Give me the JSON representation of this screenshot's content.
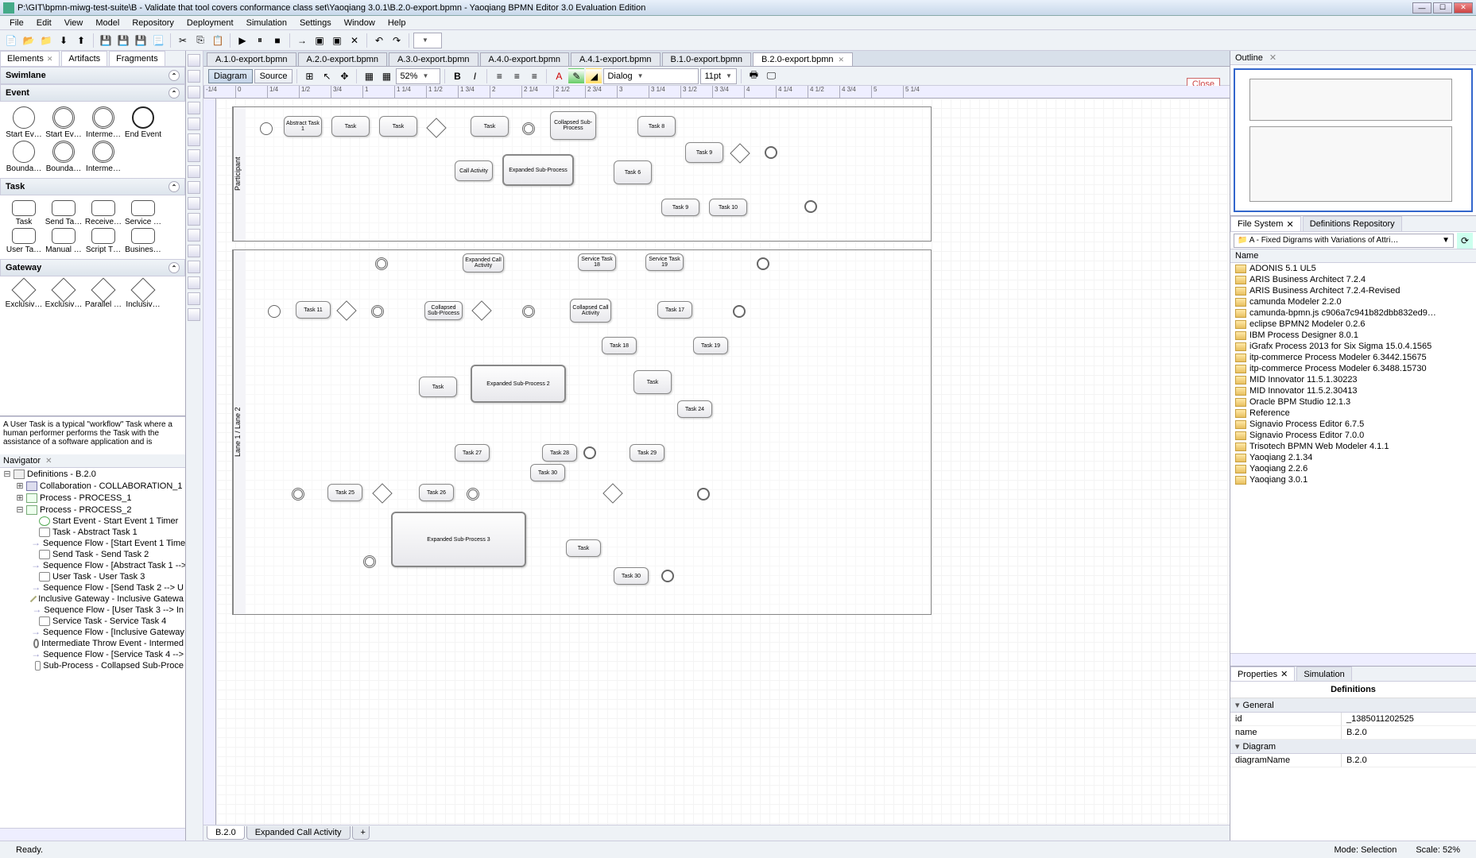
{
  "title": "P:\\GIT\\bpmn-miwg-test-suite\\B - Validate that tool covers conformance class set\\Yaoqiang 3.0.1\\B.2.0-export.bpmn - Yaoqiang BPMN Editor 3.0 Evaluation Edition",
  "menu": [
    "File",
    "Edit",
    "View",
    "Model",
    "Repository",
    "Deployment",
    "Simulation",
    "Settings",
    "Window",
    "Help"
  ],
  "palette_tabs": [
    "Elements",
    "Artifacts",
    "Fragments"
  ],
  "palette": {
    "swimlane_label": "Swimlane",
    "event_label": "Event",
    "events": [
      "Start Ev…",
      "Start Ev…",
      "Interme…",
      "End Event",
      "Bounda…",
      "Bounda…",
      "Interme…"
    ],
    "task_label": "Task",
    "tasks": [
      "Task",
      "Send Ta…",
      "Receive…",
      "Service …",
      "User Ta…",
      "Manual …",
      "Script T…",
      "Busines…"
    ],
    "gateway_label": "Gateway",
    "gateways": [
      "Exclusiv…",
      "Exclusiv…",
      "Parallel …",
      "Inclusiv…"
    ]
  },
  "description": "A User Task is a typical \"workflow\" Task where a human performer performs the Task with the assistance of a software application and is",
  "navigator_label": "Navigator",
  "navigator_tree": [
    {
      "d": 0,
      "t": "tw",
      "ico": "def",
      "label": "Definitions - B.2.0",
      "open": true
    },
    {
      "d": 1,
      "t": "tw",
      "ico": "collab",
      "label": "Collaboration - COLLABORATION_1",
      "open": false
    },
    {
      "d": 1,
      "t": "tw",
      "ico": "proc",
      "label": "Process - PROCESS_1",
      "open": false
    },
    {
      "d": 1,
      "t": "tw",
      "ico": "proc",
      "label": "Process - PROCESS_2",
      "open": true
    },
    {
      "d": 2,
      "t": "",
      "ico": "start",
      "label": "Start Event - Start Event 1 Timer"
    },
    {
      "d": 2,
      "t": "",
      "ico": "task",
      "label": "Task - Abstract Task 1"
    },
    {
      "d": 2,
      "t": "",
      "ico": "flow",
      "label": "Sequence Flow - [Start Event 1 Time"
    },
    {
      "d": 2,
      "t": "",
      "ico": "task",
      "label": "Send Task - Send Task 2"
    },
    {
      "d": 2,
      "t": "",
      "ico": "flow",
      "label": "Sequence Flow - [Abstract Task 1 -->"
    },
    {
      "d": 2,
      "t": "",
      "ico": "task",
      "label": "User Task - User Task 3"
    },
    {
      "d": 2,
      "t": "",
      "ico": "flow",
      "label": "Sequence Flow - [Send Task 2 --> U"
    },
    {
      "d": 2,
      "t": "",
      "ico": "gw",
      "label": "Inclusive Gateway - Inclusive Gatewa"
    },
    {
      "d": 2,
      "t": "",
      "ico": "flow",
      "label": "Sequence Flow - [User Task 3 --> In"
    },
    {
      "d": 2,
      "t": "",
      "ico": "task",
      "label": "Service Task - Service Task 4"
    },
    {
      "d": 2,
      "t": "",
      "ico": "flow",
      "label": "Sequence Flow - [Inclusive Gateway"
    },
    {
      "d": 2,
      "t": "",
      "ico": "inter",
      "label": "Intermediate Throw Event - Intermed"
    },
    {
      "d": 2,
      "t": "",
      "ico": "flow",
      "label": "Sequence Flow - [Service Task 4 -->"
    },
    {
      "d": 2,
      "t": "",
      "ico": "sub",
      "label": "Sub-Process - Collapsed Sub-Proce"
    }
  ],
  "editor_tabs": [
    "A.1.0-export.bpmn",
    "A.2.0-export.bpmn",
    "A.3.0-export.bpmn",
    "A.4.0-export.bpmn",
    "A.4.1-export.bpmn",
    "B.1.0-export.bpmn",
    "B.2.0-export.bpmn"
  ],
  "editor_active_tab": 6,
  "view_mode": {
    "diagram": "Diagram",
    "source": "Source"
  },
  "zoom": "52%",
  "font": "Dialog",
  "font_size": "11pt",
  "close_label": "Close",
  "ruler_ticks": [
    "-1/4",
    "0",
    "1/4",
    "1/2",
    "3/4",
    "1",
    "1 1/4",
    "1 1/2",
    "1 3/4",
    "2",
    "2 1/4",
    "2 1/2",
    "2 3/4",
    "3",
    "3 1/4",
    "3 1/2",
    "3 3/4",
    "4",
    "4 1/4",
    "4 1/2",
    "4 3/4",
    "5",
    "5 1/4"
  ],
  "bottom_tabs": [
    "B.2.0",
    "Expanded Call Activity"
  ],
  "outline_label": "Outline",
  "fs_tabs": [
    "File System",
    "Definitions Repository"
  ],
  "fs_combo": "A - Fixed Digrams with Variations of Attri…",
  "fs_header": "Name",
  "fs_items": [
    "ADONIS 5.1 UL5",
    "ARIS Business Architect 7.2.4",
    "ARIS Business Architect 7.2.4-Revised",
    "camunda Modeler 2.2.0",
    "camunda-bpmn.js c906a7c941b82dbb832ed9…",
    "eclipse BPMN2 Modeler 0.2.6",
    "IBM Process Designer 8.0.1",
    "iGrafx Process 2013 for Six Sigma 15.0.4.1565",
    "itp-commerce Process Modeler 6.3442.15675",
    "itp-commerce Process Modeler 6.3488.15730",
    "MID Innovator 11.5.1.30223",
    "MID Innovator 11.5.2.30413",
    "Oracle BPM Studio 12.1.3",
    "Reference",
    "Signavio Process Editor 6.7.5",
    "Signavio Process Editor 7.0.0",
    "Trisotech BPMN Web Modeler 4.1.1",
    "Yaoqiang 2.1.34",
    "Yaoqiang 2.2.6",
    "Yaoqiang 3.0.1"
  ],
  "props_tabs": [
    "Properties",
    "Simulation"
  ],
  "props_title": "Definitions",
  "props": {
    "general_label": "General",
    "id_label": "id",
    "id_value": "_1385011202525",
    "name_label": "name",
    "name_value": "B.2.0",
    "diagram_label": "Diagram",
    "dname_label": "diagramName",
    "dname_value": "B.2.0"
  },
  "status": {
    "ready": "Ready.",
    "mode": "Mode: Selection",
    "scale": "Scale: 52%"
  }
}
